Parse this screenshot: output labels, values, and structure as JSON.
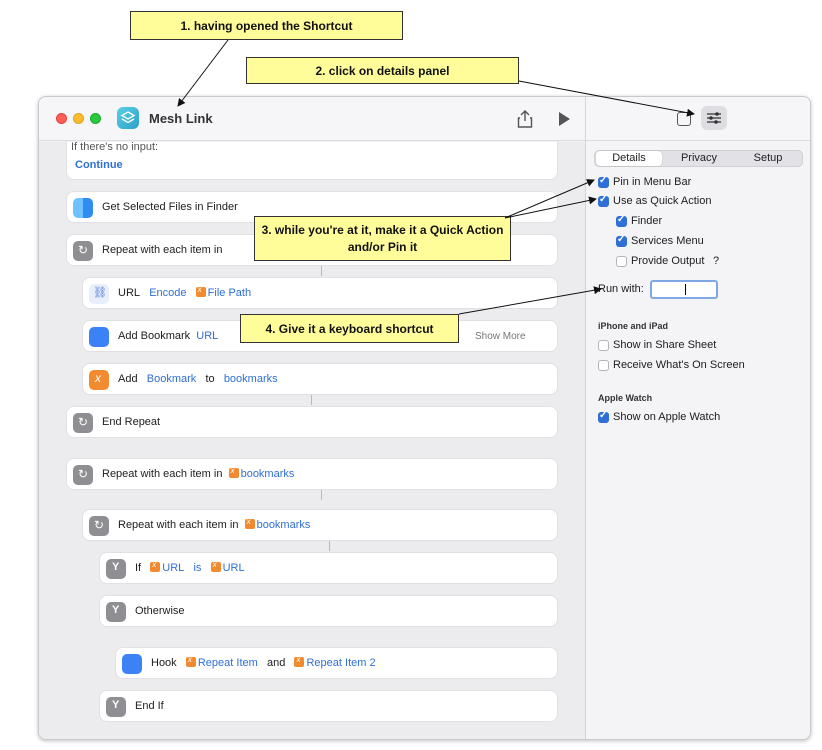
{
  "window": {
    "title": "Mesh Link"
  },
  "editor": {
    "no_input_label": "If there's no input:",
    "continue_label": "Continue",
    "rows": {
      "get_files": "Get Selected Files in Finder",
      "repeat1": "Repeat with each item in",
      "url_label": "URL",
      "encode": "Encode",
      "file_path": "File Path",
      "add_bookmark": "Add Bookmark",
      "url_token": "URL",
      "show_more": "Show More",
      "add": "Add",
      "bookmark_token": "Bookmark",
      "to": "to",
      "bookmarks": "bookmarks",
      "end_repeat": "End Repeat",
      "repeat2": "Repeat with each item in",
      "repeat2_var": "bookmarks",
      "repeat3": "Repeat with each item in",
      "repeat3_var": "bookmarks",
      "if": "If",
      "if_url": "URL",
      "is": "is",
      "if_url2": "URL",
      "otherwise": "Otherwise",
      "hook": "Hook",
      "repeat_item": "Repeat Item",
      "and": "and",
      "repeat_item2": "Repeat Item 2",
      "end_if": "End If"
    }
  },
  "sidebar": {
    "tabs": [
      {
        "label": "Details",
        "active": true
      },
      {
        "label": "Privacy",
        "active": false
      },
      {
        "label": "Setup",
        "active": false
      }
    ],
    "pin_menu_bar": "Pin in Menu Bar",
    "quick_action": "Use as Quick Action",
    "finder": "Finder",
    "services_menu": "Services Menu",
    "provide_output": "Provide Output",
    "help": "?",
    "run_with": "Run with:",
    "iphone_head": "iPhone and iPad",
    "share_sheet": "Show in Share Sheet",
    "receive_screen": "Receive What's On Screen",
    "watch_head": "Apple Watch",
    "show_watch": "Show on Apple Watch"
  },
  "callouts": {
    "c1": "1. having opened the Shortcut",
    "c2": "2. click on details panel",
    "c3": "3. while you're at it, make it a Quick Action and/or Pin it",
    "c4": "4. Give it a keyboard shortcut"
  },
  "colors": {
    "accent": "#2f6fd6",
    "callout": "#fffd9a",
    "variable": "#f28b30"
  }
}
